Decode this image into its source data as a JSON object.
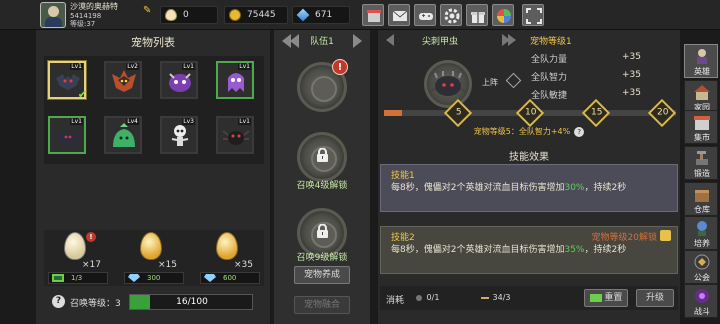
{
  "player": {
    "name": "沙漠的奥赫特",
    "id": "5414198",
    "level_text": "等级:37"
  },
  "resources": {
    "eggs": "0",
    "coins": "75445",
    "gems": "671"
  },
  "toolbar": [
    "shop-icon",
    "mail-icon",
    "gamepad-icon",
    "settings-gear-icon",
    "gift-icon",
    "color-wheel-icon",
    "fullscreen-icon"
  ],
  "pet_list": {
    "title": "宠物列表",
    "pets": [
      {
        "level": "Lv1",
        "kind": "bat",
        "selected": true,
        "frame": "gold"
      },
      {
        "level": "Lv2",
        "kind": "flame-bat",
        "frame": "plain"
      },
      {
        "level": "Lv1",
        "kind": "purple-demon",
        "frame": "plain"
      },
      {
        "level": "Lv1",
        "kind": "purple-ghost",
        "frame": "green"
      },
      {
        "level": "Lv1",
        "kind": "shadow-bat",
        "frame": "green"
      },
      {
        "level": "Lv4",
        "kind": "green-slime",
        "frame": "plain"
      },
      {
        "level": "Lv3",
        "kind": "skeleton",
        "frame": "plain"
      },
      {
        "level": "Lv1",
        "kind": "black-spider",
        "frame": "plain"
      }
    ]
  },
  "egg_shop": [
    {
      "count": "×17",
      "cost": "1/3",
      "badge": "!"
    },
    {
      "count": "×15",
      "cost": "300"
    },
    {
      "count": "×35",
      "cost": "600"
    }
  ],
  "summon": {
    "label": "召唤等级：3",
    "progress_text": "16/100",
    "progress": 0.16
  },
  "team": {
    "label": "队伍1",
    "slot1_badge": "!",
    "lock1": "召唤4级解锁",
    "lock2": "召唤9级解锁",
    "btn_raise": "宠物养成",
    "btn_fusion": "宠物融合"
  },
  "detail": {
    "pet_name": "尖刺甲虫",
    "pet_level": "宠物等级1",
    "deploy_label": "上阵",
    "stats": [
      {
        "label": "全队力量",
        "value": "+35"
      },
      {
        "label": "全队智力",
        "value": "+35"
      },
      {
        "label": "全队敏捷",
        "value": "+35"
      }
    ],
    "milestones": [
      "5",
      "10",
      "15",
      "20"
    ],
    "level_progress": 0.04,
    "hint": "宠物等级5：全队智力+4%",
    "hint_icon": "?",
    "skills_title": "技能效果",
    "skill1": {
      "name": "技能1",
      "desc_pre": "每8秒，傀儡对2个英雄对流血目标伤害增加",
      "pct": "30%",
      "desc_post": "，持续2秒"
    },
    "skill2": {
      "name": "技能2",
      "req": "宠物等级20解锁",
      "desc_pre": "每8秒，傀儡对2个英雄对流血目标伤害增加",
      "pct": "35%",
      "desc_post": "，持续2秒"
    },
    "cost_label": "消耗",
    "cost1": "0/1",
    "cost2": "34/3",
    "reset_btn": "重置",
    "upgrade_btn": "升级"
  },
  "side_nav": [
    {
      "label": "英雄",
      "icon": "hero-icon"
    },
    {
      "label": "家园",
      "icon": "home-icon"
    },
    {
      "label": "集市",
      "icon": "market-icon"
    },
    {
      "label": "锻造",
      "icon": "forge-icon"
    },
    {
      "label": "仓库",
      "icon": "warehouse-icon"
    },
    {
      "label": "培养",
      "icon": "train-icon"
    },
    {
      "label": "公会",
      "icon": "guild-icon"
    },
    {
      "label": "战斗",
      "icon": "battle-icon"
    }
  ]
}
